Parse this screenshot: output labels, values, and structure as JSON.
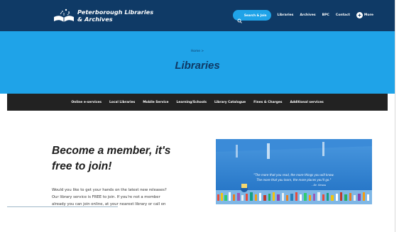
{
  "header": {
    "logo_line1": "Peterborough Libraries",
    "logo_line2": "& Archives",
    "search_label": "Search & Join",
    "nav": [
      "Libraries",
      "Archives",
      "BPC",
      "Contact"
    ],
    "more_label": "More"
  },
  "hero": {
    "breadcrumb": "Home >",
    "title": "Libraries"
  },
  "subnav": [
    "Online e-services",
    "Local Libraries",
    "Mobile Service",
    "Learning/Schools",
    "Library Catalogue",
    "Fines & Charges",
    "Additional services"
  ],
  "content": {
    "headline_line1": "Become a member, it's",
    "headline_line2": "free to join!",
    "body_line1": "Would you like to get your hands on the latest new releases?",
    "body_line2": "Our library service is FREE to join. If you're not a member",
    "body_line3": "already you can join online, at your nearest library or call on"
  },
  "photo": {
    "quote_line1": "\"The more that you read, the more things you will know.",
    "quote_line2": "The more that you learn, the more places you'll go.\"",
    "quote_author": "- Dr. Seuss"
  },
  "colors": {
    "header_bg": "#0f3a66",
    "hero_bg": "#1fa3e8",
    "subnav_bg": "#222222",
    "accent": "#1fa3e8"
  }
}
